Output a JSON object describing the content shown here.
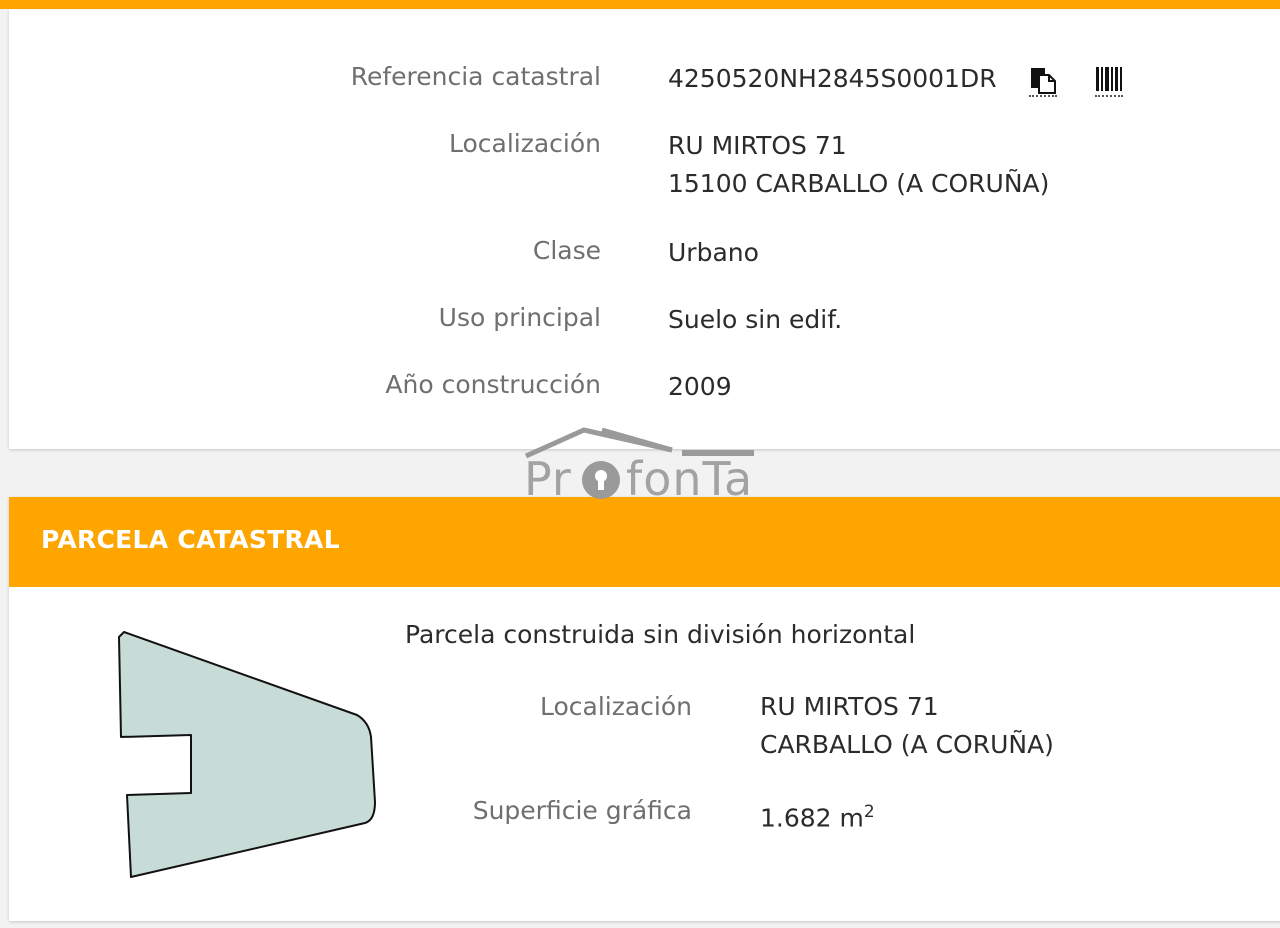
{
  "summary": {
    "rows": [
      {
        "label": "Referencia catastral",
        "value": "4250520NH2845S0001DR"
      },
      {
        "label": "Localización",
        "value": "RU MIRTOS 71",
        "value2": "15100 CARBALLO (A CORUÑA)"
      },
      {
        "label": "Clase",
        "value": "Urbano"
      },
      {
        "label": "Uso principal",
        "value": "Suelo sin edif."
      },
      {
        "label": "Año construcción",
        "value": "2009"
      }
    ],
    "icons": {
      "copy": "copy-icon",
      "barcode": "barcode-icon"
    }
  },
  "parcela": {
    "title": "PARCELA CATASTRAL",
    "subtitle": "Parcela construida sin división horizontal",
    "rows": [
      {
        "label": "Localización",
        "value": "RU MIRTOS 71",
        "value2": "CARBALLO (A CORUÑA)"
      },
      {
        "label": "Superficie gráfica",
        "value": "1.682 m",
        "sup": "2"
      }
    ],
    "parcel_fill": "#c7dcd6"
  },
  "watermark": {
    "text_left": "Pr",
    "text_right": "fonTa"
  },
  "colors": {
    "accent": "#fea500",
    "label": "#6f6f6f",
    "value": "#2b2b2b"
  }
}
